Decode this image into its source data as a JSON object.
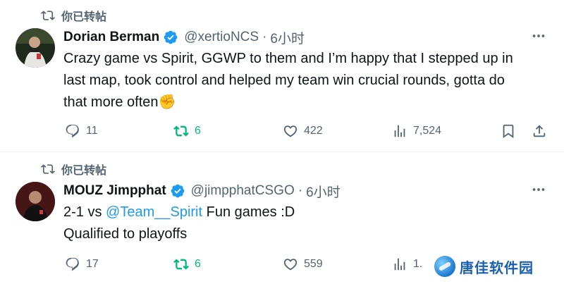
{
  "colors": {
    "text": "#0f1419",
    "secondary": "#536471",
    "accent": "#1d9bf0",
    "retweet_active": "#00ba7c",
    "divider": "#eff3f4"
  },
  "tweets": [
    {
      "retweet_label": "你已转帖",
      "name": "Dorian Berman",
      "handle": "@xertioNCS",
      "dot": "·",
      "time": "6小时",
      "text_lines": [
        "Crazy game vs Spirit, GGWP to them and I’m happy that I stepped up in",
        "last map, took control and helped my team win crucial rounds, gotta do",
        "that more often"
      ],
      "emoji": "✊",
      "emoji_icon": "raised-fist-icon",
      "counts": {
        "reply": "11",
        "retweet": "6",
        "like": "422",
        "views": "7,524"
      }
    },
    {
      "retweet_label": "你已转帖",
      "name": "MOUZ Jimpphat",
      "handle": "@jimpphatCSGO",
      "dot": "·",
      "time": "6小时",
      "line1_prefix": "2-1 vs ",
      "mention": "@Team__Spirit",
      "line1_suffix": " Fun games :D",
      "line2": "Qualified to playoffs",
      "counts": {
        "reply": "17",
        "retweet": "6",
        "like": "559",
        "views": "1."
      }
    }
  ],
  "watermark": {
    "text": "唐佳软件园"
  }
}
